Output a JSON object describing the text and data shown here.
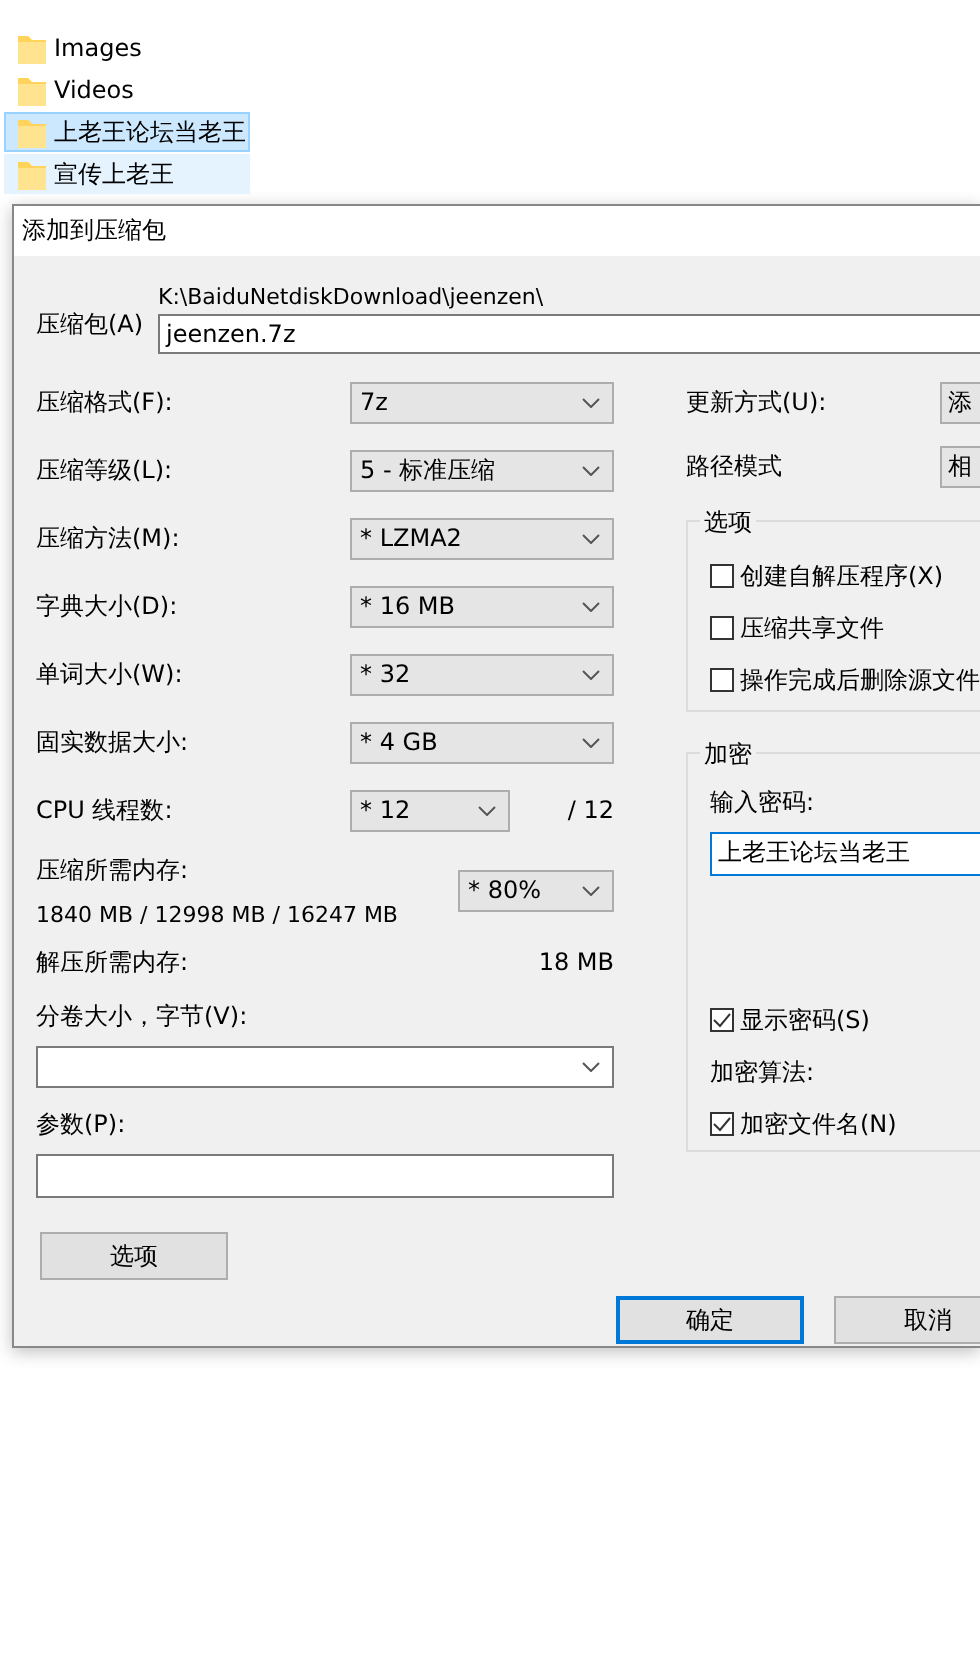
{
  "explorer": {
    "items": [
      {
        "name": "Images",
        "selected": false,
        "focused": false
      },
      {
        "name": "Videos",
        "selected": false,
        "focused": false
      },
      {
        "name": "上老王论坛当老王",
        "selected": true,
        "focused": true
      },
      {
        "name": "宣传上老王",
        "selected": true,
        "focused": false
      }
    ]
  },
  "dialog": {
    "title": "添加到压缩包",
    "archive": {
      "label": "压缩包(A)",
      "path": "K:\\BaiduNetdiskDownload\\jeenzen\\",
      "filename": "jeenzen.7z"
    },
    "settings": [
      {
        "kind": "combo",
        "label": "压缩格式(F):",
        "value": "7z"
      },
      {
        "kind": "combo",
        "label": "压缩等级(L):",
        "value": "5 - 标准压缩"
      },
      {
        "kind": "combo",
        "label": "压缩方法(M):",
        "value": "* LZMA2"
      },
      {
        "kind": "combo",
        "label": "字典大小(D):",
        "value": "* 16 MB"
      },
      {
        "kind": "combo",
        "label": "单词大小(W):",
        "value": "* 32"
      },
      {
        "kind": "combo",
        "label": "固实数据大小:",
        "value": "* 4 GB"
      },
      {
        "kind": "threads",
        "label": "CPU 线程数:",
        "value": "* 12",
        "total": "/ 12"
      },
      {
        "kind": "memory",
        "label": "压缩所需内存:",
        "detail": "1840 MB / 12998 MB / 16247 MB",
        "value": "* 80%"
      },
      {
        "kind": "readout",
        "label": "解压所需内存:",
        "value": "18 MB"
      }
    ],
    "split": {
      "label": "分卷大小，字节(V):"
    },
    "params": {
      "label": "参数(P):"
    },
    "options_button": "选项",
    "update": {
      "label": "更新方式(U):",
      "value": "添"
    },
    "path_mode": {
      "label": "路径模式",
      "value": "相"
    },
    "options": {
      "title": "选项",
      "items": [
        {
          "label": "创建自解压程序(X)",
          "checked": false
        },
        {
          "label": "压缩共享文件",
          "checked": false
        },
        {
          "label": "操作完成后删除源文件",
          "checked": false
        }
      ]
    },
    "encryption": {
      "title": "加密",
      "password_label": "输入密码:",
      "password": "上老王论坛当老王",
      "show_password": {
        "label": "显示密码(S)",
        "checked": true
      },
      "method_label": "加密算法:",
      "encrypt_names": {
        "label": "加密文件名(N)",
        "checked": true
      }
    },
    "buttons": [
      {
        "label": "确定",
        "default": true
      },
      {
        "label": "取消",
        "default": false
      }
    ]
  }
}
